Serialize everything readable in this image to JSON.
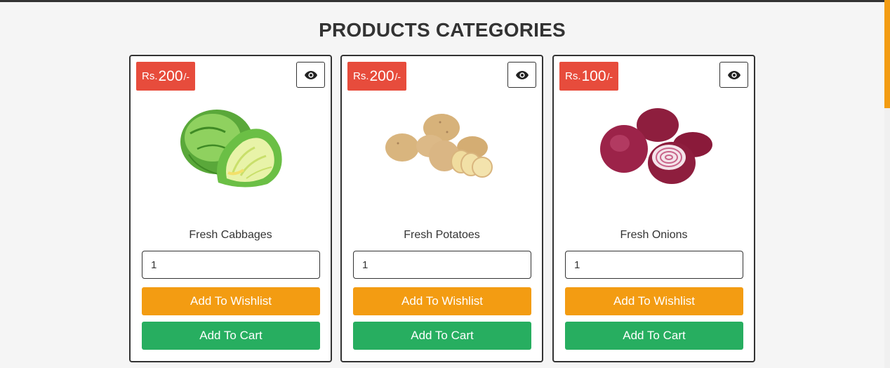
{
  "page_title": "PRODUCTS CATEGORIES",
  "colors": {
    "price_badge": "#e74c3c",
    "wishlist_button": "#f39c12",
    "cart_button": "#27ae60",
    "scroll_thumb": "#f39c12"
  },
  "products": [
    {
      "price_prefix": "Rs.",
      "price": "200",
      "price_suffix": "/-",
      "image_icon": "cabbage-image",
      "name": "Fresh Cabbages",
      "quantity": "1",
      "wishlist_label": "Add To Wishlist",
      "cart_label": "Add To Cart",
      "view_icon": "eye-icon"
    },
    {
      "price_prefix": "Rs.",
      "price": "200",
      "price_suffix": "/-",
      "image_icon": "potatoes-image",
      "name": "Fresh Potatoes",
      "quantity": "1",
      "wishlist_label": "Add To Wishlist",
      "cart_label": "Add To Cart",
      "view_icon": "eye-icon"
    },
    {
      "price_prefix": "Rs.",
      "price": "100",
      "price_suffix": "/-",
      "image_icon": "onions-image",
      "name": "Fresh Onions",
      "quantity": "1",
      "wishlist_label": "Add To Wishlist",
      "cart_label": "Add To Cart",
      "view_icon": "eye-icon"
    }
  ]
}
